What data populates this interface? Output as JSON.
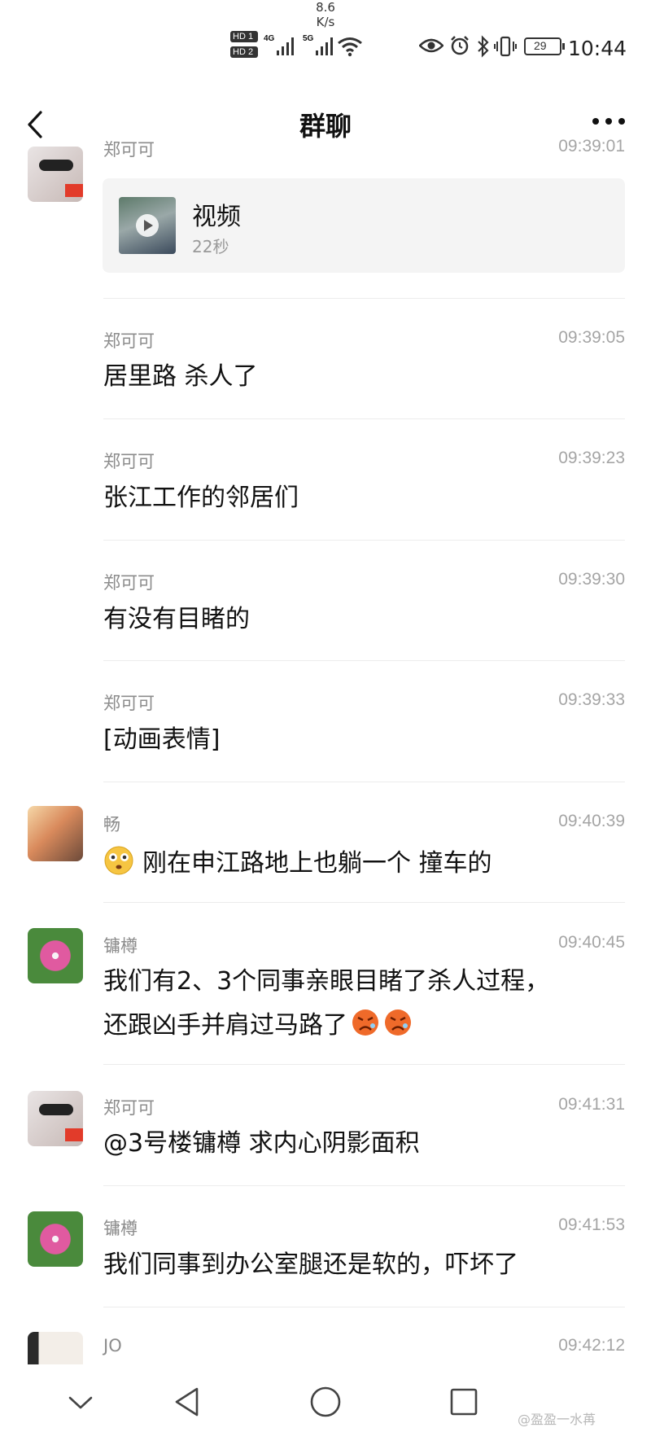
{
  "status_bar": {
    "hd1": "HD 1",
    "hd2": "HD 2",
    "net1": "4G",
    "net2": "5G",
    "speed_value": "8.6",
    "speed_unit": "K/s",
    "battery": "29",
    "time": "10:44",
    "icons": [
      "hd-icon",
      "signal-icon",
      "wifi-icon",
      "eye-icon",
      "alarm-icon",
      "bluetooth-icon",
      "vibrate-icon",
      "battery-icon"
    ]
  },
  "nav": {
    "title": "群聊"
  },
  "messages": [
    {
      "name": "郑可可",
      "time": "09:39:01",
      "video": {
        "label": "视频",
        "duration": "22秒"
      }
    },
    {
      "name": "郑可可",
      "time": "09:39:05",
      "text": "居里路 杀人了"
    },
    {
      "name": "郑可可",
      "time": "09:39:23",
      "text": "张江工作的邻居们"
    },
    {
      "name": "郑可可",
      "time": "09:39:30",
      "text": "有没有目睹的"
    },
    {
      "name": "郑可可",
      "time": "09:39:33",
      "text": "[动画表情]"
    },
    {
      "name": "畅",
      "time": "09:40:39",
      "text": "刚在申江路地上也躺一个 撞车的"
    },
    {
      "name": "镛樽",
      "time": "09:40:45",
      "text_line1": "我们有2、3个同事亲眼目睹了杀人过程，",
      "text_line2": "还跟凶手并肩过马路了"
    },
    {
      "name": "郑可可",
      "time": "09:41:31",
      "text": "@3号楼镛樽 求内心阴影面积"
    },
    {
      "name": "镛樽",
      "time": "09:41:53",
      "text": "我们同事到办公室腿还是软的，吓坏了"
    },
    {
      "name": "JO",
      "time": "09:42:12"
    }
  ],
  "bottom_nav": [
    "chevron-down-icon",
    "back-triangle-icon",
    "home-circle-icon",
    "recents-square-icon"
  ],
  "watermark": "@盈盈一水苒"
}
